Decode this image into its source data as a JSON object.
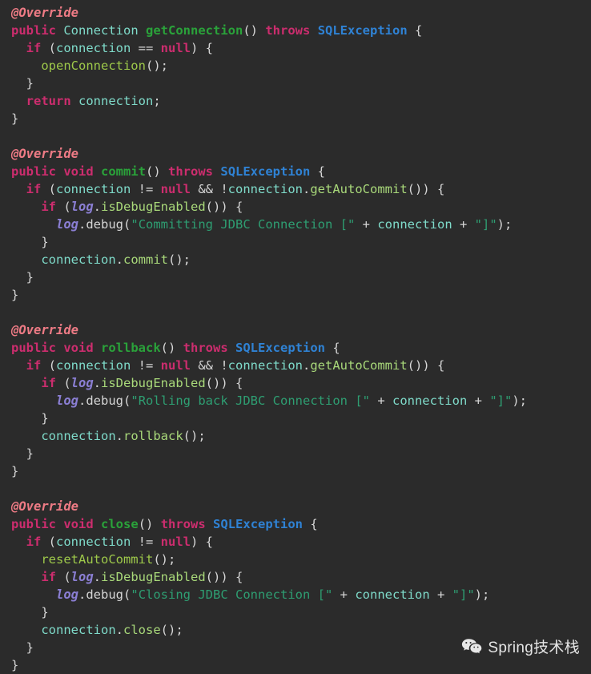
{
  "editor": {
    "background_color": "#2b2b2b",
    "language": "java",
    "theme": "dark",
    "colors": {
      "annotation": "#ee7b85",
      "keyword": "#cc2d6e",
      "type": "#7fdbca",
      "method_declaration": "#2aa23a",
      "method_call": "#9ec94a",
      "exception_type": "#2f82d4",
      "variable": "#7fdbca",
      "field": "#8b7fd4",
      "string": "#2e9e72",
      "plain": "#d6d6d6"
    }
  },
  "code": {
    "lines": [
      [
        [
          "@Override",
          "t-ann"
        ]
      ],
      [
        [
          "public",
          "t-kw"
        ],
        [
          " ",
          "t-plain"
        ],
        [
          "Connection",
          "t-type"
        ],
        [
          " ",
          "t-plain"
        ],
        [
          "getConnection",
          "t-decl"
        ],
        [
          "() ",
          "t-punc"
        ],
        [
          "throws",
          "t-kw"
        ],
        [
          " ",
          "t-plain"
        ],
        [
          "SQLException",
          "t-excep"
        ],
        [
          " {",
          "t-punc"
        ]
      ],
      [
        [
          "  ",
          "t-plain"
        ],
        [
          "if",
          "t-kw"
        ],
        [
          " (",
          "t-punc"
        ],
        [
          "connection",
          "t-var"
        ],
        [
          " == ",
          "t-plain"
        ],
        [
          "null",
          "t-kw"
        ],
        [
          ") {",
          "t-punc"
        ]
      ],
      [
        [
          "    ",
          "t-plain"
        ],
        [
          "openConnection",
          "t-call"
        ],
        [
          "();",
          "t-punc"
        ]
      ],
      [
        [
          "  }",
          "t-punc"
        ]
      ],
      [
        [
          "  ",
          "t-plain"
        ],
        [
          "return",
          "t-kw"
        ],
        [
          " ",
          "t-plain"
        ],
        [
          "connection",
          "t-var"
        ],
        [
          ";",
          "t-punc"
        ]
      ],
      [
        [
          "}",
          "t-punc"
        ]
      ],
      [
        [
          "",
          "t-plain"
        ]
      ],
      [
        [
          "@Override",
          "t-ann"
        ]
      ],
      [
        [
          "public",
          "t-kw"
        ],
        [
          " ",
          "t-plain"
        ],
        [
          "void",
          "t-kw"
        ],
        [
          " ",
          "t-plain"
        ],
        [
          "commit",
          "t-decl"
        ],
        [
          "() ",
          "t-punc"
        ],
        [
          "throws",
          "t-kw"
        ],
        [
          " ",
          "t-plain"
        ],
        [
          "SQLException",
          "t-excep"
        ],
        [
          " {",
          "t-punc"
        ]
      ],
      [
        [
          "  ",
          "t-plain"
        ],
        [
          "if",
          "t-kw"
        ],
        [
          " (",
          "t-punc"
        ],
        [
          "connection",
          "t-var"
        ],
        [
          " != ",
          "t-plain"
        ],
        [
          "null",
          "t-kw"
        ],
        [
          " && !",
          "t-plain"
        ],
        [
          "connection",
          "t-var"
        ],
        [
          ".",
          "t-punc"
        ],
        [
          "getAutoCommit",
          "t-mcall"
        ],
        [
          "()) {",
          "t-punc"
        ]
      ],
      [
        [
          "    ",
          "t-plain"
        ],
        [
          "if",
          "t-kw"
        ],
        [
          " (",
          "t-punc"
        ],
        [
          "log",
          "t-field"
        ],
        [
          ".",
          "t-punc"
        ],
        [
          "isDebugEnabled",
          "t-mcall"
        ],
        [
          "()) {",
          "t-punc"
        ]
      ],
      [
        [
          "      ",
          "t-plain"
        ],
        [
          "log",
          "t-field"
        ],
        [
          ".",
          "t-punc"
        ],
        [
          "debug",
          "t-plain"
        ],
        [
          "(",
          "t-punc"
        ],
        [
          "\"Committing JDBC Connection [\"",
          "t-str"
        ],
        [
          " + ",
          "t-plain"
        ],
        [
          "connection",
          "t-var"
        ],
        [
          " + ",
          "t-plain"
        ],
        [
          "\"]\"",
          "t-str"
        ],
        [
          ");",
          "t-punc"
        ]
      ],
      [
        [
          "    }",
          "t-punc"
        ]
      ],
      [
        [
          "    ",
          "t-plain"
        ],
        [
          "connection",
          "t-var"
        ],
        [
          ".",
          "t-punc"
        ],
        [
          "commit",
          "t-mcall"
        ],
        [
          "();",
          "t-punc"
        ]
      ],
      [
        [
          "  }",
          "t-punc"
        ]
      ],
      [
        [
          "}",
          "t-punc"
        ]
      ],
      [
        [
          "",
          "t-plain"
        ]
      ],
      [
        [
          "@Override",
          "t-ann"
        ]
      ],
      [
        [
          "public",
          "t-kw"
        ],
        [
          " ",
          "t-plain"
        ],
        [
          "void",
          "t-kw"
        ],
        [
          " ",
          "t-plain"
        ],
        [
          "rollback",
          "t-decl"
        ],
        [
          "() ",
          "t-punc"
        ],
        [
          "throws",
          "t-kw"
        ],
        [
          " ",
          "t-plain"
        ],
        [
          "SQLException",
          "t-excep"
        ],
        [
          " {",
          "t-punc"
        ]
      ],
      [
        [
          "  ",
          "t-plain"
        ],
        [
          "if",
          "t-kw"
        ],
        [
          " (",
          "t-punc"
        ],
        [
          "connection",
          "t-var"
        ],
        [
          " != ",
          "t-plain"
        ],
        [
          "null",
          "t-kw"
        ],
        [
          " && !",
          "t-plain"
        ],
        [
          "connection",
          "t-var"
        ],
        [
          ".",
          "t-punc"
        ],
        [
          "getAutoCommit",
          "t-mcall"
        ],
        [
          "()) {",
          "t-punc"
        ]
      ],
      [
        [
          "    ",
          "t-plain"
        ],
        [
          "if",
          "t-kw"
        ],
        [
          " (",
          "t-punc"
        ],
        [
          "log",
          "t-field"
        ],
        [
          ".",
          "t-punc"
        ],
        [
          "isDebugEnabled",
          "t-mcall"
        ],
        [
          "()) {",
          "t-punc"
        ]
      ],
      [
        [
          "      ",
          "t-plain"
        ],
        [
          "log",
          "t-field"
        ],
        [
          ".",
          "t-punc"
        ],
        [
          "debug",
          "t-plain"
        ],
        [
          "(",
          "t-punc"
        ],
        [
          "\"Rolling back JDBC Connection [\"",
          "t-str"
        ],
        [
          " + ",
          "t-plain"
        ],
        [
          "connection",
          "t-var"
        ],
        [
          " + ",
          "t-plain"
        ],
        [
          "\"]\"",
          "t-str"
        ],
        [
          ");",
          "t-punc"
        ]
      ],
      [
        [
          "    }",
          "t-punc"
        ]
      ],
      [
        [
          "    ",
          "t-plain"
        ],
        [
          "connection",
          "t-var"
        ],
        [
          ".",
          "t-punc"
        ],
        [
          "rollback",
          "t-mcall"
        ],
        [
          "();",
          "t-punc"
        ]
      ],
      [
        [
          "  }",
          "t-punc"
        ]
      ],
      [
        [
          "}",
          "t-punc"
        ]
      ],
      [
        [
          "",
          "t-plain"
        ]
      ],
      [
        [
          "@Override",
          "t-ann"
        ]
      ],
      [
        [
          "public",
          "t-kw"
        ],
        [
          " ",
          "t-plain"
        ],
        [
          "void",
          "t-kw"
        ],
        [
          " ",
          "t-plain"
        ],
        [
          "close",
          "t-decl"
        ],
        [
          "() ",
          "t-punc"
        ],
        [
          "throws",
          "t-kw"
        ],
        [
          " ",
          "t-plain"
        ],
        [
          "SQLException",
          "t-excep"
        ],
        [
          " {",
          "t-punc"
        ]
      ],
      [
        [
          "  ",
          "t-plain"
        ],
        [
          "if",
          "t-kw"
        ],
        [
          " (",
          "t-punc"
        ],
        [
          "connection",
          "t-var"
        ],
        [
          " != ",
          "t-plain"
        ],
        [
          "null",
          "t-kw"
        ],
        [
          ") {",
          "t-punc"
        ]
      ],
      [
        [
          "    ",
          "t-plain"
        ],
        [
          "resetAutoCommit",
          "t-call"
        ],
        [
          "();",
          "t-punc"
        ]
      ],
      [
        [
          "    ",
          "t-plain"
        ],
        [
          "if",
          "t-kw"
        ],
        [
          " (",
          "t-punc"
        ],
        [
          "log",
          "t-field"
        ],
        [
          ".",
          "t-punc"
        ],
        [
          "isDebugEnabled",
          "t-mcall"
        ],
        [
          "()) {",
          "t-punc"
        ]
      ],
      [
        [
          "      ",
          "t-plain"
        ],
        [
          "log",
          "t-field"
        ],
        [
          ".",
          "t-punc"
        ],
        [
          "debug",
          "t-plain"
        ],
        [
          "(",
          "t-punc"
        ],
        [
          "\"Closing JDBC Connection [\"",
          "t-str"
        ],
        [
          " + ",
          "t-plain"
        ],
        [
          "connection",
          "t-var"
        ],
        [
          " + ",
          "t-plain"
        ],
        [
          "\"]\"",
          "t-str"
        ],
        [
          ");",
          "t-punc"
        ]
      ],
      [
        [
          "    }",
          "t-punc"
        ]
      ],
      [
        [
          "    ",
          "t-plain"
        ],
        [
          "connection",
          "t-var"
        ],
        [
          ".",
          "t-punc"
        ],
        [
          "close",
          "t-mcall"
        ],
        [
          "();",
          "t-punc"
        ]
      ],
      [
        [
          "  }",
          "t-punc"
        ]
      ],
      [
        [
          "}",
          "t-punc"
        ]
      ]
    ]
  },
  "watermark": {
    "icon": "wechat-icon",
    "text": "Spring技术栈"
  }
}
